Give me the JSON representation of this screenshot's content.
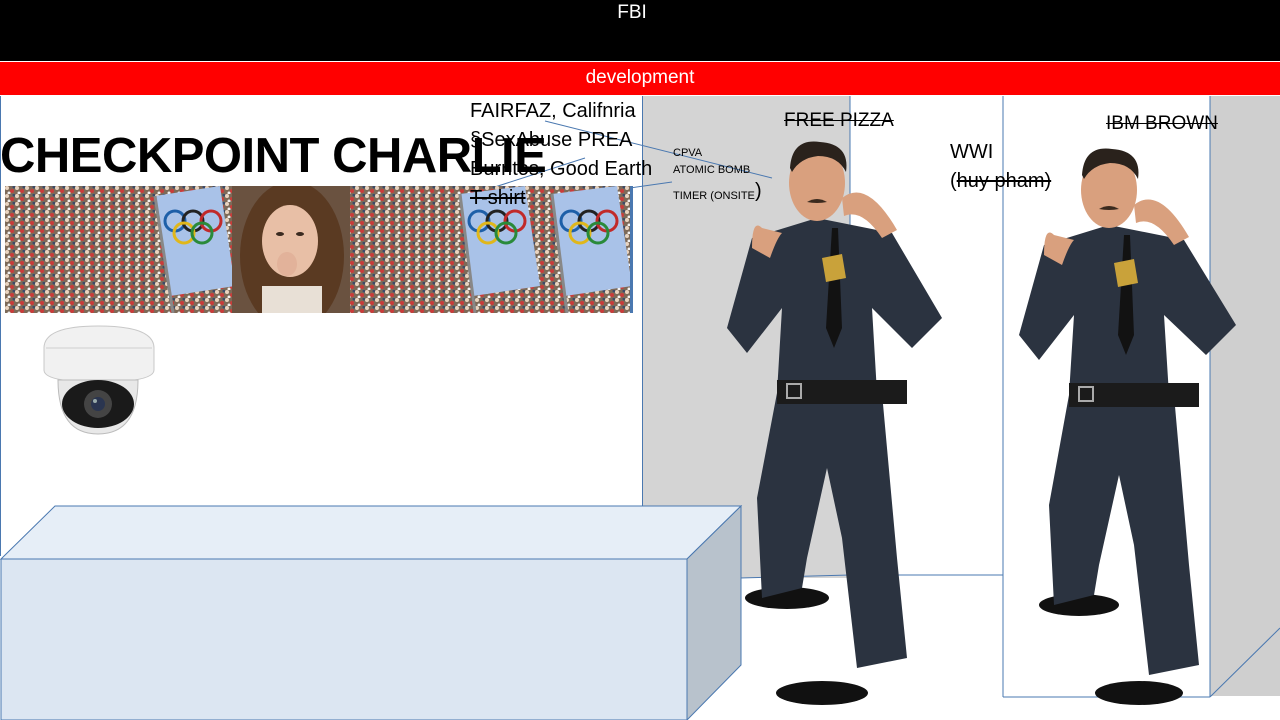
{
  "header": {
    "title": "FBI",
    "banner": "development"
  },
  "scene": {
    "heading": "CHECKPOINT CHARLIE",
    "notes": [
      "FAIRFAZ, Califnria",
      "§SexAbuse PREA",
      "Burritos, Good Earth",
      "T-shirt"
    ],
    "small_notes": [
      "CPVA",
      "ATOMIC BOMB",
      "TIMER (ONSITE"
    ],
    "paren": ")",
    "free_pizza": "FREE PIZZA",
    "ibm_brown": "IBM BROWN",
    "wwi": "WWI",
    "huy_open": "(",
    "huy_name": "huy pham)"
  },
  "colors": {
    "top_bar": "#000000",
    "banner": "#ff0000",
    "counter": "#dce6f2",
    "wall": "#d4d4d4",
    "uniform": "#2b3340"
  },
  "icons": [
    "security-camera-icon",
    "police-officer-figure",
    "olympic-flag-photo",
    "crowd-photo",
    "woman-photo"
  ]
}
